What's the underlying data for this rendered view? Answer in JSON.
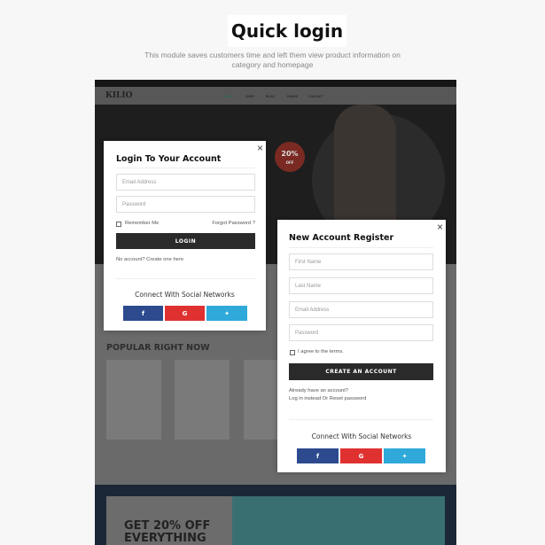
{
  "page": {
    "title": "Quick login",
    "subtitle": "This module saves customers time and left them view product information on category and homepage"
  },
  "site": {
    "logo": "KILIO",
    "nav": [
      "HOME",
      "SHOP",
      "BLOG",
      "PAGES",
      "CONTACT"
    ],
    "hero_badge": {
      "value": "20%",
      "label": "OFF"
    },
    "section_title": "POPULAR RIGHT NOW",
    "banner": {
      "line1": "GET 20% OFF",
      "line2": "EVERYTHING"
    }
  },
  "login": {
    "title": "Login To Your Account",
    "email_placeholder": "Email Address",
    "password_placeholder": "Password",
    "remember": "Remember Me",
    "forgot": "Forgot Password ?",
    "button": "LOGIN",
    "no_account": "No account? Create one here",
    "connect": "Connect With Social Networks"
  },
  "register": {
    "title": "New Account Register",
    "first_placeholder": "First Name",
    "last_placeholder": "Last Name",
    "email_placeholder": "Email Address",
    "password_placeholder": "Password",
    "agree": "I agree to the terms.",
    "button": "CREATE AN ACCOUNT",
    "already": "Already have an account?",
    "login_link": "Log in instead Or Reset password",
    "connect": "Connect With Social Networks"
  },
  "social": {
    "facebook": "f",
    "google": "G",
    "twitter": "✦",
    "colors": {
      "facebook": "#2d4a8f",
      "google": "#e03131",
      "twitter": "#2fa9d9"
    }
  }
}
